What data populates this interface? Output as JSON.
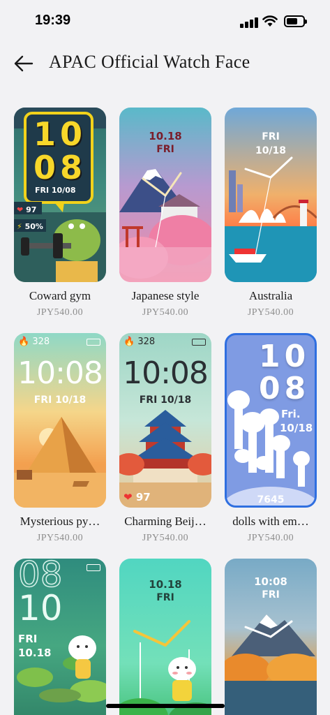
{
  "status_bar": {
    "time": "19:39"
  },
  "header": {
    "title": "APAC Official Watch Face"
  },
  "faces": [
    {
      "name": "Coward gym",
      "price": "JPY540.00",
      "hour": "10",
      "minute": "08",
      "date": "FRI 10/08",
      "heart": "97",
      "battery": "50%"
    },
    {
      "name": "Japanese style",
      "price": "JPY540.00",
      "date": "10.18",
      "day": "FRI"
    },
    {
      "name": "Australia",
      "price": "JPY540.00",
      "day": "FRI",
      "date": "10/18"
    },
    {
      "name": "Mysterious py…",
      "price": "JPY540.00",
      "calories": "328",
      "time": "10:08",
      "date": "FRI 10/18"
    },
    {
      "name": "Charming Beij…",
      "price": "JPY540.00",
      "calories": "328",
      "time": "10:08",
      "date": "FRI 10/18",
      "heart": "97"
    },
    {
      "name": "dolls with em…",
      "price": "JPY540.00",
      "hour": "10",
      "minute": "08",
      "day": "Fri.",
      "date": "10/18",
      "steps": "7645"
    },
    {
      "name": "",
      "price": "",
      "hour": "08",
      "minute": "10",
      "day": "FRI",
      "date": "10.18"
    },
    {
      "name": "",
      "price": "",
      "date": "10.18",
      "day": "FRI"
    },
    {
      "name": "",
      "price": "",
      "time": "10:08",
      "day": "FRI"
    }
  ]
}
